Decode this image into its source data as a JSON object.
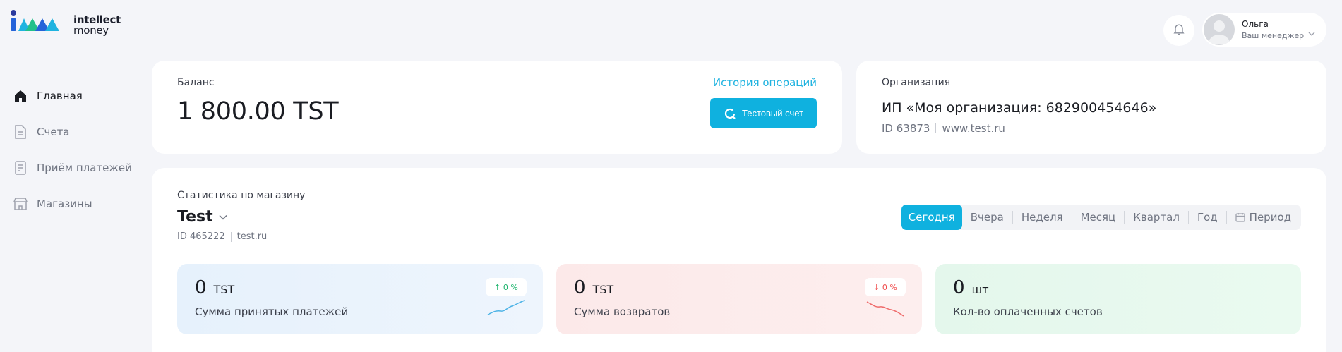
{
  "logo": {
    "line1": "intellect",
    "line2": "money"
  },
  "header": {
    "user_name": "Ольга",
    "user_role": "Ваш менеджер"
  },
  "sidebar": {
    "items": [
      {
        "label": "Главная",
        "icon": "home-icon",
        "active": true
      },
      {
        "label": "Счета",
        "icon": "document-icon",
        "active": false
      },
      {
        "label": "Приём платежей",
        "icon": "receipt-icon",
        "active": false
      },
      {
        "label": "Магазины",
        "icon": "store-icon",
        "active": false
      }
    ]
  },
  "balance": {
    "label": "Баланс",
    "value": "1 800.00 TST",
    "history_link": "История операций",
    "test_button": "Тестовый счет"
  },
  "organization": {
    "label": "Организация",
    "name": "ИП «Моя организация: 682900454646»",
    "id": "ID 63873",
    "site": "www.test.ru"
  },
  "stats": {
    "title": "Статистика по магазину",
    "shop_name": "Test",
    "shop_id": "ID 465222",
    "shop_site": "test.ru",
    "periods": [
      "Сегодня",
      "Вчера",
      "Неделя",
      "Месяц",
      "Квартал",
      "Год",
      "Период"
    ],
    "active_period": "Сегодня",
    "metrics": [
      {
        "value": "0",
        "unit": "TST",
        "label": "Сумма принятых платежей",
        "badge": "0 %",
        "trend": "up",
        "color": "#1ab36b"
      },
      {
        "value": "0",
        "unit": "TST",
        "label": "Сумма возвратов",
        "badge": "0 %",
        "trend": "down",
        "color": "#ef4b4b"
      },
      {
        "value": "0",
        "unit": "шт",
        "label": "Кол-во оплаченных счетов"
      }
    ]
  },
  "colors": {
    "accent": "#0fb1df",
    "link": "#1fb3e0",
    "background": "#f4f5f9"
  }
}
